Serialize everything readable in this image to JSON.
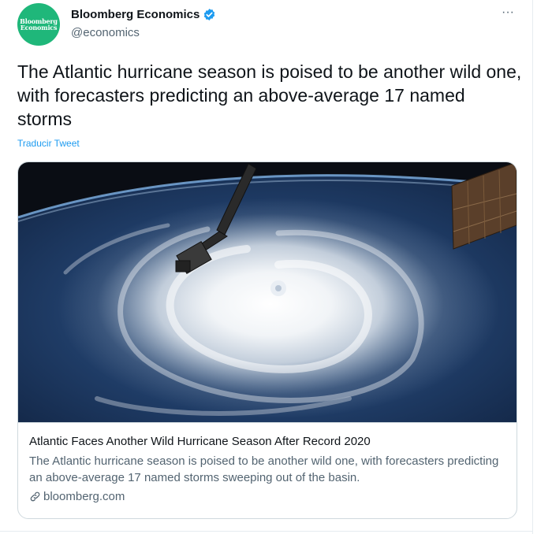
{
  "author": {
    "display_name": "Bloomberg Economics",
    "handle": "@economics",
    "avatar_text": [
      "Bloomberg",
      "Economics"
    ],
    "verified": true
  },
  "tweet": {
    "text": "The Atlantic hurricane season is poised to be another wild one, with forecasters predicting an above-average 17 named storms",
    "translate_label": "Traducir Tweet",
    "more_label": "···"
  },
  "card": {
    "image_subject": "hurricane-from-space",
    "title": "Atlantic Faces Another Wild Hurricane Season After Record 2020",
    "description": "The Atlantic hurricane season is poised to be another wild one, with forecasters predicting an above-average 17 named storms sweeping out of the basin.",
    "domain": "bloomberg.com"
  },
  "colors": {
    "avatar_bg": "#1fb77a",
    "verified_blue": "#1d9bf0",
    "link_blue": "#1d9bf0",
    "secondary_text": "#536471"
  }
}
